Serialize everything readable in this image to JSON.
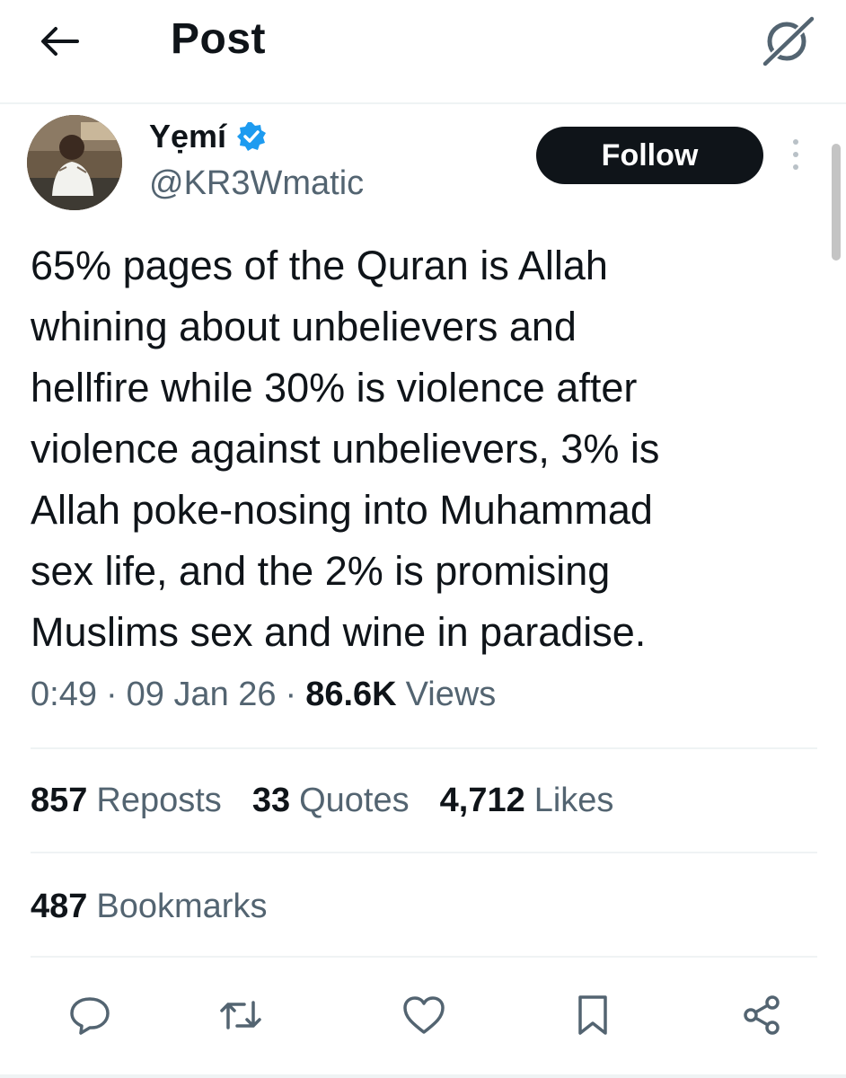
{
  "header": {
    "back_icon": "arrow-left-icon",
    "title": "Post",
    "grok_icon": "grok-icon"
  },
  "author": {
    "name": "Yẹmí",
    "handle": "@KR3Wmatic",
    "verified_color": "#1d9bf0",
    "follow_label": "Follow"
  },
  "tweet": {
    "text": "65% pages of the Quran is Allah\nwhining about unbelievers and\nhellfire while 30% is violence after\nviolence against unbelievers, 3% is\nAllah poke-nosing into Muhammad\nsex life, and the 2% is promising\nMuslims sex and wine in paradise.",
    "time": "0:49",
    "date": "09 Jan 26",
    "separator": "·",
    "views_count": "86.6K",
    "views_label": "Views"
  },
  "stats": {
    "reposts_count": "857",
    "reposts_label": "Reposts",
    "quotes_count": "33",
    "quotes_label": "Quotes",
    "likes_count": "4,712",
    "likes_label": "Likes",
    "bookmarks_count": "487",
    "bookmarks_label": "Bookmarks"
  },
  "actions": [
    "reply-icon",
    "repost-icon",
    "like-icon",
    "bookmark-icon",
    "share-icon"
  ],
  "colors": {
    "text": "#0f1419",
    "secondary": "#536471",
    "divider": "#eff3f4",
    "accent": "#1d9bf0"
  }
}
